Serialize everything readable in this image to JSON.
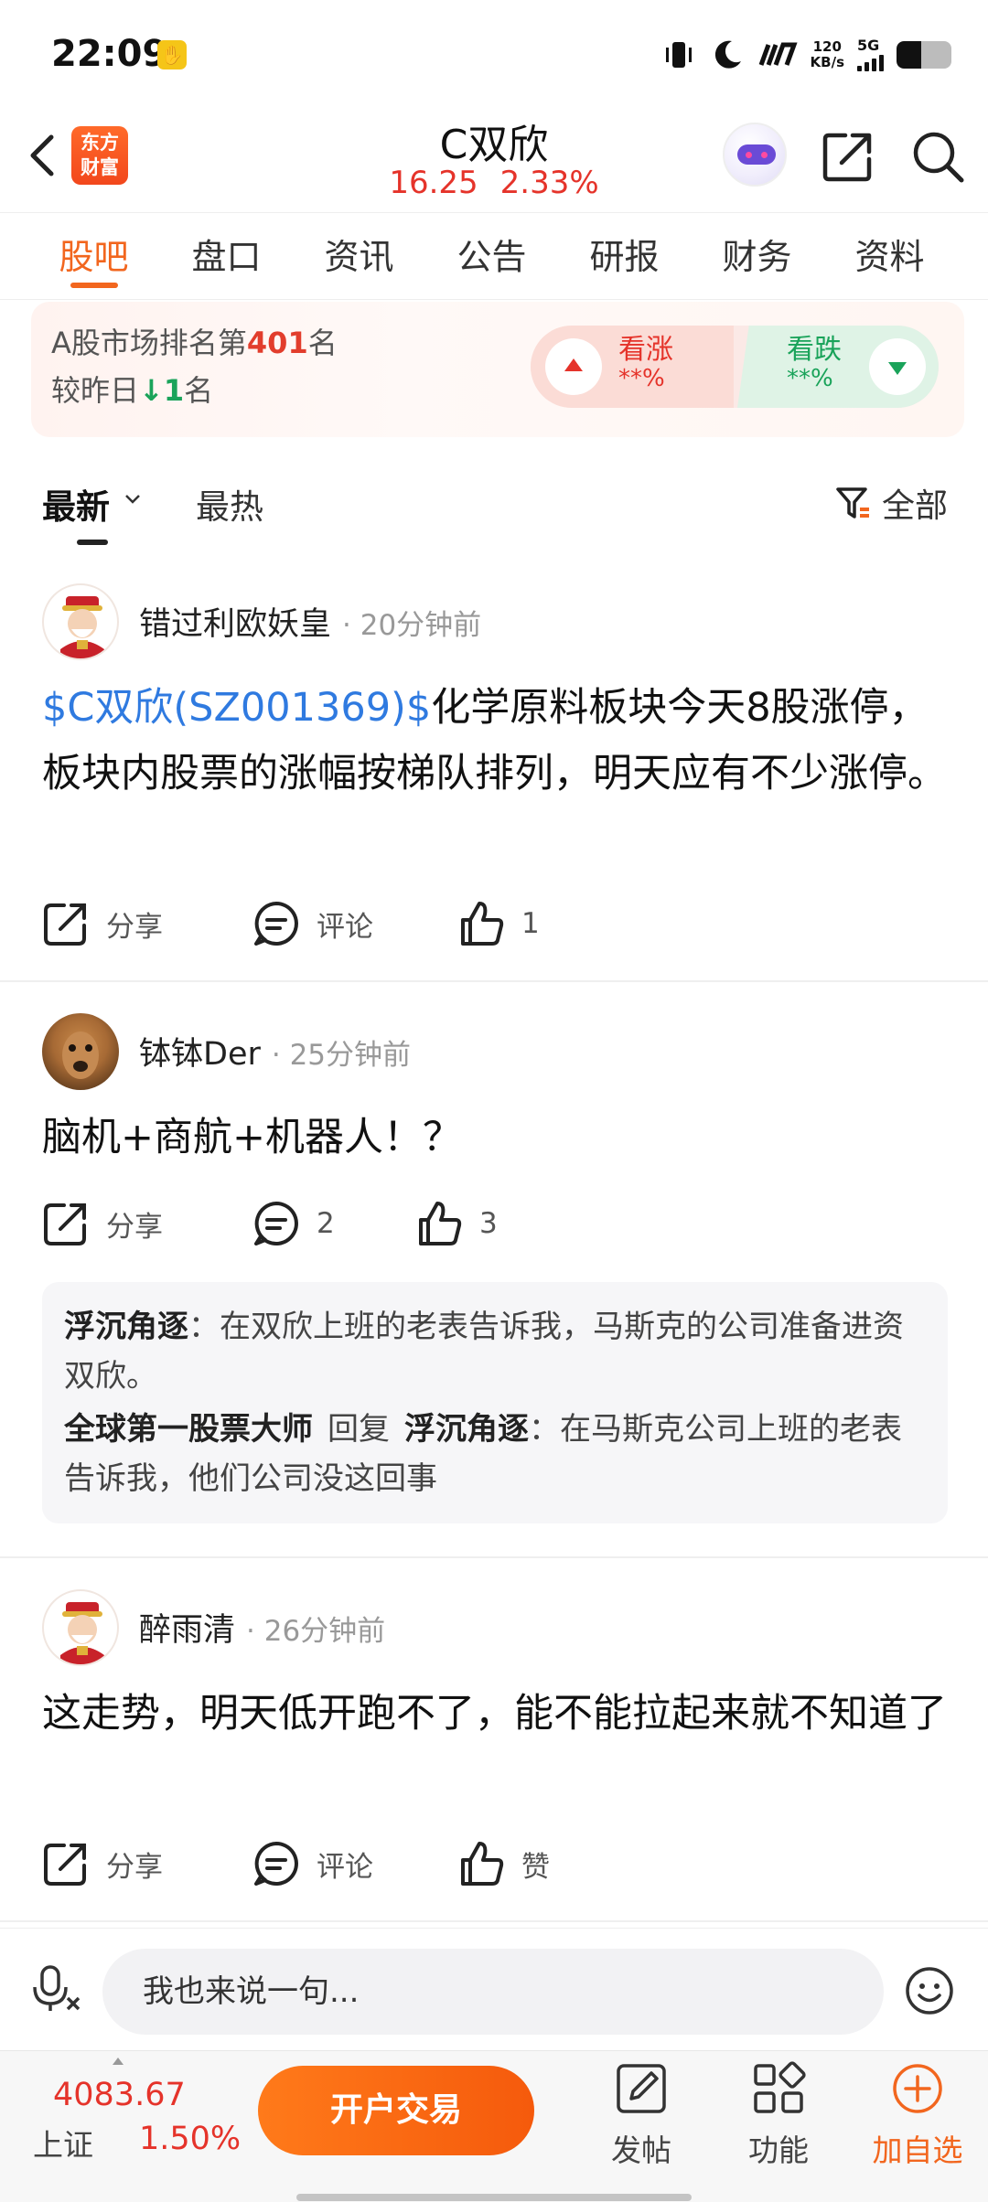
{
  "status_bar": {
    "time": "22:09",
    "net_speed_value": "120",
    "net_speed_unit": "KB/s",
    "network": "5G",
    "battery_level": 0.45
  },
  "header": {
    "app_logo": [
      "东方",
      "财富"
    ],
    "stock_name": "C双欣",
    "price": "16.25",
    "change_pct": "2.33%"
  },
  "tabs": [
    "股吧",
    "盘口",
    "资讯",
    "公告",
    "研报",
    "财务",
    "资料"
  ],
  "active_tab": 0,
  "rank_banner": {
    "line1_prefix": "A股市场排名第",
    "rank": "401",
    "line1_suffix": "名",
    "line2_prefix": "较昨日",
    "change": "1",
    "line2_suffix": "名",
    "bull_label": "看涨",
    "bull_value": "**%",
    "bear_label": "看跌",
    "bear_value": "**%"
  },
  "filter": {
    "latest": "最新",
    "hot": "最热",
    "all": "全部"
  },
  "posts": [
    {
      "user": "错过利欧妖皇",
      "time": "· 20分钟前",
      "cashtag": "$C双欣(SZ001369)$",
      "text": "化学原料板块今天8股涨停，板块内股票的涨幅按梯队排列，明天应有不少涨停。",
      "share": "分享",
      "comment": "评论",
      "like": "1"
    },
    {
      "user": "钵钵Der",
      "time": "· 25分钟前",
      "text": "脑机+商航+机器人！？",
      "share": "分享",
      "comment": "2",
      "like": "3",
      "replies": [
        {
          "user": "浮沉角逐",
          "text": "：在双欣上班的老表告诉我，马斯克的公司准备进资双欣。"
        },
        {
          "user": "全球第一股票大师",
          "reply_word": "回复",
          "to": "浮沉角逐",
          "text": "：在马斯克公司上班的老表告诉我，他们公司没这回事"
        }
      ]
    },
    {
      "user": "醉雨清",
      "time": "· 26分钟前",
      "text": "这走势，明天低开跑不了，能不能拉起来就不知道了",
      "share": "分享",
      "comment": "评论",
      "like": "赞"
    }
  ],
  "comment_bar": {
    "placeholder": "我也来说一句..."
  },
  "bottom_bar": {
    "index_value": "4083.67",
    "index_name": "上证",
    "index_pct": "1.50%",
    "open_button": "开户交易",
    "post": "发帖",
    "functions": "功能",
    "add_watch": "加自选"
  },
  "colors": {
    "accent": "#f2661e",
    "up": "#e5332a",
    "down": "#1aa35a",
    "link": "#2f7ae0"
  },
  "icons": [
    "back-icon",
    "share-icon",
    "search-icon",
    "robot-icon",
    "filter-icon",
    "comment-icon",
    "like-icon",
    "mic-icon",
    "emoji-icon",
    "edit-icon",
    "grid-icon",
    "add-icon"
  ]
}
